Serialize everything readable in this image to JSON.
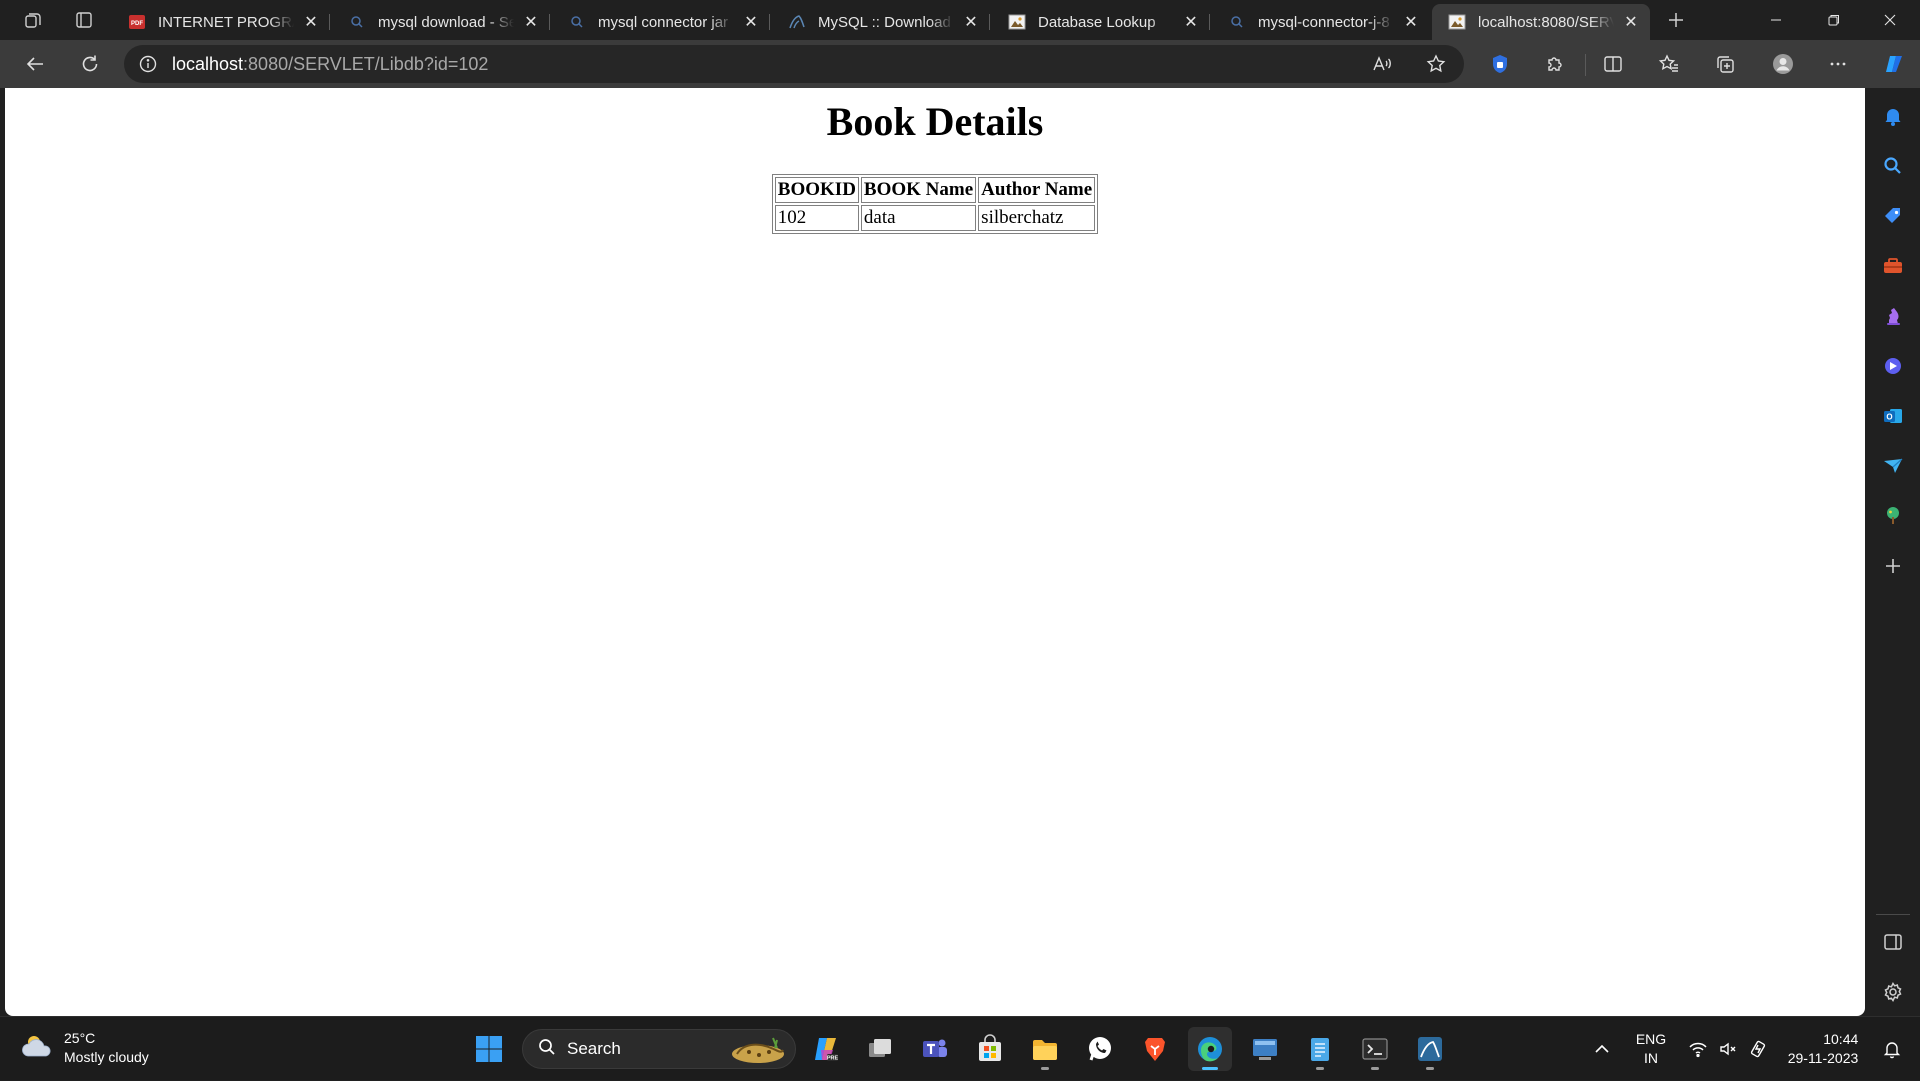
{
  "browser": {
    "tabs": [
      {
        "title": "INTERNET PROGRAM",
        "icon": "pdf-icon",
        "active": false
      },
      {
        "title": "mysql download - Se",
        "icon": "search-icon",
        "active": false
      },
      {
        "title": "mysql connector jar",
        "icon": "search-icon",
        "active": false
      },
      {
        "title": "MySQL :: Download C",
        "icon": "mysql-icon",
        "active": false
      },
      {
        "title": "Database Lookup",
        "icon": "image-icon",
        "active": false
      },
      {
        "title": "mysql-connector-j-8",
        "icon": "search-icon",
        "active": false
      },
      {
        "title": "localhost:8080/SERVL",
        "icon": "image-icon",
        "active": true
      }
    ],
    "address_host": "localhost",
    "address_rest": ":8080/SERVLET/Libdb?id=102"
  },
  "page": {
    "heading": "Book Details",
    "table": {
      "headers": [
        "BOOKID",
        "BOOK Name",
        "Author Name"
      ],
      "rows": [
        [
          "102",
          "data",
          "silberchatz"
        ]
      ]
    }
  },
  "taskbar": {
    "weather": {
      "temp": "25°C",
      "condition": "Mostly cloudy"
    },
    "search_label": "Search",
    "language": {
      "line1": "ENG",
      "line2": "IN"
    },
    "clock": {
      "time": "10:44",
      "date": "29-11-2023"
    }
  },
  "colors": {
    "accent": "#4cc2ff",
    "titlebar": "#202020",
    "toolbar": "#3b3b3b"
  }
}
